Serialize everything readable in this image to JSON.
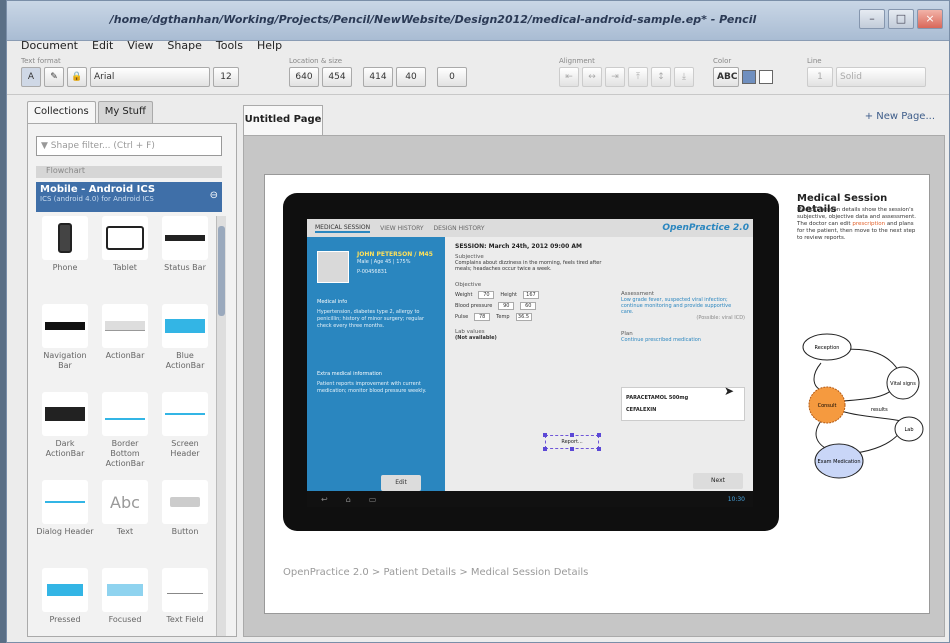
{
  "window": {
    "title": "/home/dgthanhan/Working/Projects/Pencil/NewWebsite/Design2012/medical-android-sample.ep* - Pencil",
    "buttons": [
      "–",
      "□",
      "×"
    ]
  },
  "menu": [
    "Document",
    "Edit",
    "View",
    "Shape",
    "Tools",
    "Help"
  ],
  "toolbar": {
    "font_label": "Text format",
    "font_name": "Arial",
    "font_size": "12",
    "loc_label": "Location & size",
    "x": "640",
    "y": "454",
    "w": "414",
    "h": "40",
    "angle": "0",
    "align_label": "Alignment",
    "color_label": "Color",
    "color_abc": "ABC",
    "line_label": "Line",
    "line_width": "1",
    "line_style": "Solid",
    "fill_color": "#6f8fbf"
  },
  "sidebar": {
    "tabs": [
      "Collections",
      "My Stuff"
    ],
    "filter_placeholder": "Shape filter... (Ctrl + F)",
    "prev_collection": "Flowchart",
    "collection_title": "Mobile - Android ICS",
    "collection_sub": "ICS (android 4.0) for Android ICS",
    "shapes": [
      {
        "label": "Phone",
        "icon": "phone-icon"
      },
      {
        "label": "Tablet",
        "icon": "tablet-icon"
      },
      {
        "label": "Status Bar",
        "icon": "status-bar-icon"
      },
      {
        "label": "Navigation Bar",
        "icon": "navigation-bar-icon"
      },
      {
        "label": "ActionBar",
        "icon": "actionbar-icon"
      },
      {
        "label": "Blue ActionBar",
        "icon": "blue-actionbar-icon"
      },
      {
        "label": "Dark ActionBar",
        "icon": "dark-actionbar-icon"
      },
      {
        "label": "Border Bottom ActionBar",
        "icon": "border-bottom-actionbar-icon"
      },
      {
        "label": "Screen Header",
        "icon": "screen-header-icon"
      },
      {
        "label": "Dialog Header",
        "icon": "dialog-header-icon"
      },
      {
        "label": "Text",
        "icon": "text-icon"
      },
      {
        "label": "Button",
        "icon": "button-icon"
      },
      {
        "label": "Pressed Button",
        "icon": "pressed-button-icon"
      },
      {
        "label": "Focused Button",
        "icon": "focused-button-icon"
      },
      {
        "label": "Text Field",
        "icon": "text-field-icon"
      }
    ]
  },
  "page": {
    "tab": "Untitled Page",
    "new_page": "+ New Page..."
  },
  "mockup": {
    "tabs": [
      "MEDICAL SESSION",
      "VIEW HISTORY",
      "DESIGN HISTORY"
    ],
    "logo": "OpenPractice 2.0",
    "patient_name": "JOHN PETERSON / M45",
    "patient_demo": "Male | Age 45 | 175%",
    "patient_id": "P-00456831",
    "medical_info_label": "Medical info",
    "medical_info": "Hypertension, diabetes type 2, allergy to penicillin; history of minor surgery; regular check every three months.",
    "extra_info_label": "Extra medical information",
    "extra_info": "Patient reports improvement with current medication; monitor blood pressure weekly.",
    "left_btn": "Edit",
    "session": "SESSION: March 24th, 2012 09:00 AM",
    "subjective_label": "Subjective",
    "subjective": "Complains about dizziness in the morning, feels tired after meals; headaches occur twice a week.",
    "objective_label": "Objective",
    "weight_label": "Weight",
    "weight": "70",
    "height_label": "Height",
    "height": "167",
    "bp_label": "Blood pressure",
    "bp_sys": "90",
    "bp_dia": "60",
    "pulse_label": "Pulse",
    "pulse": "78",
    "temp_label": "Temp",
    "temp": "36.5",
    "lab_label": "Lab values",
    "lab_value": "(Not available)",
    "report_btn": "Report...",
    "assessment_label": "Assessment",
    "assessment": "Low grade fever, suspected viral infection; continue monitoring and provide supportive care.",
    "assessment_more": "(Possible: viral ICD)",
    "plan_label": "Plan",
    "plan": "Continue prescribed medication",
    "rx1": "PARACETAMOL 500mg",
    "rx2": "CEFALEXIN",
    "next_btn": "Next",
    "nav_icons": [
      "back-icon",
      "home-icon",
      "recent-apps-icon"
    ],
    "clock": "10:30"
  },
  "notes": {
    "title": "Medical Session Details",
    "text_before": "Medical session details show the session's subjective, objective data and assessment. The doctor can edit",
    "text_red": "prescription",
    "text_after": "and plans for the patient, then move to the next step to review reports."
  },
  "diagram": {
    "nodes": [
      "Reception",
      "Consult",
      "Vital signs",
      "Lab",
      "Exam Medication"
    ],
    "edge_label": "results",
    "consult_color": "#f59a3f",
    "exam_color": "#c9d6f7"
  },
  "breadcrumb": "OpenPractice 2.0 > Patient Details > Medical Session Details"
}
